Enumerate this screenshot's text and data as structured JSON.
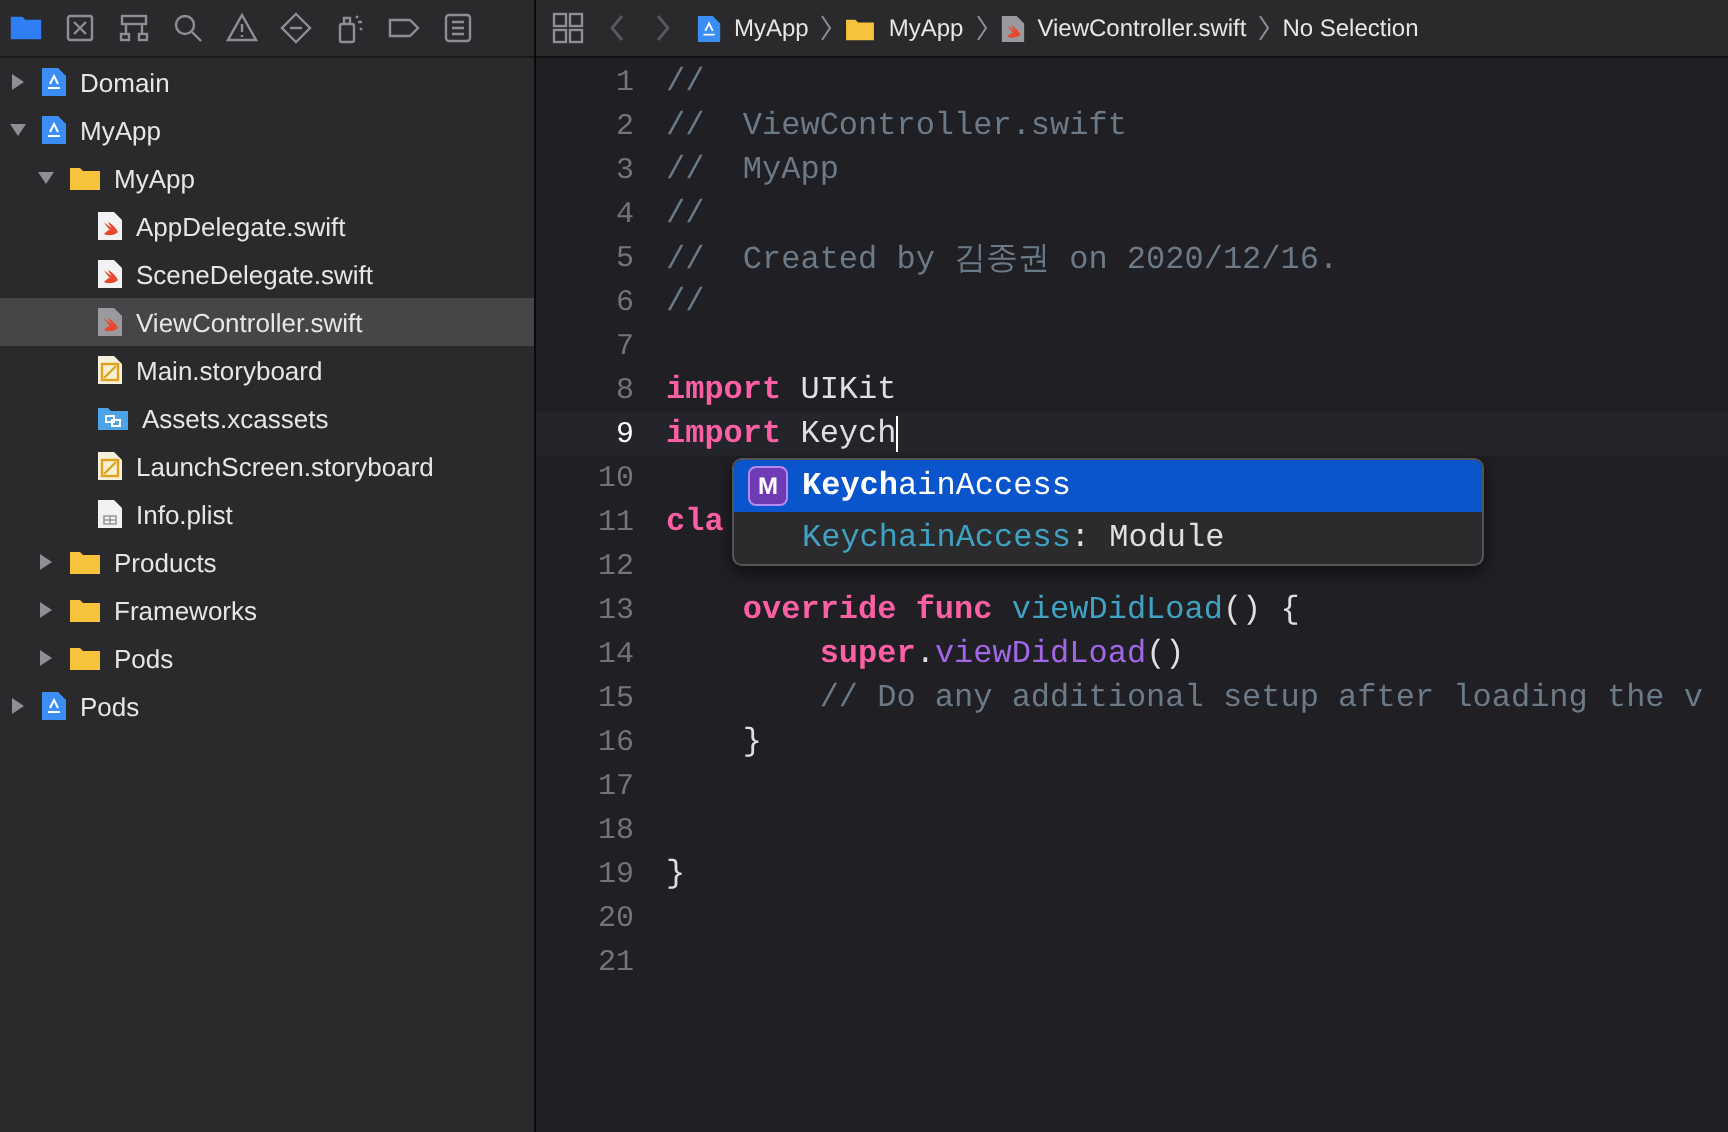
{
  "navigator": {
    "tabs": [
      {
        "kind": "folder",
        "selected": true
      },
      {
        "kind": "source-control",
        "selected": false
      },
      {
        "kind": "hierarchy",
        "selected": false
      },
      {
        "kind": "search",
        "selected": false
      },
      {
        "kind": "warning",
        "selected": false
      },
      {
        "kind": "test",
        "selected": false
      },
      {
        "kind": "debug",
        "selected": false
      },
      {
        "kind": "breakpoint",
        "selected": false
      },
      {
        "kind": "report",
        "selected": false
      }
    ],
    "tree": [
      {
        "label": "Domain",
        "kind": "project",
        "expanded": false,
        "selected": false
      },
      {
        "label": "MyApp",
        "kind": "project",
        "expanded": true,
        "selected": false,
        "children": [
          {
            "label": "MyApp",
            "kind": "folder",
            "expanded": true,
            "selected": false,
            "children": [
              {
                "label": "AppDelegate.swift",
                "kind": "swift",
                "selected": false
              },
              {
                "label": "SceneDelegate.swift",
                "kind": "swift",
                "selected": false
              },
              {
                "label": "ViewController.swift",
                "kind": "swift",
                "selected": true
              },
              {
                "label": "Main.storyboard",
                "kind": "storyboard",
                "selected": false
              },
              {
                "label": "Assets.xcassets",
                "kind": "assets",
                "selected": false
              },
              {
                "label": "LaunchScreen.storyboard",
                "kind": "storyboard",
                "selected": false
              },
              {
                "label": "Info.plist",
                "kind": "plist",
                "selected": false
              }
            ]
          },
          {
            "label": "Products",
            "kind": "folder",
            "expanded": false,
            "selected": false
          },
          {
            "label": "Frameworks",
            "kind": "folder",
            "expanded": false,
            "selected": false
          },
          {
            "label": "Pods",
            "kind": "folder",
            "expanded": false,
            "selected": false
          }
        ]
      },
      {
        "label": "Pods",
        "kind": "project",
        "expanded": false,
        "selected": false
      }
    ]
  },
  "breadcrumb": [
    {
      "kind": "project",
      "label": "MyApp"
    },
    {
      "kind": "folder",
      "label": "MyApp"
    },
    {
      "kind": "swift",
      "label": "ViewController.swift"
    },
    {
      "kind": "none",
      "label": "No Selection"
    }
  ],
  "editor": {
    "lines": [
      {
        "number": "1",
        "current": false,
        "tokens": [
          {
            "kind": "comment",
            "text": "//"
          }
        ]
      },
      {
        "number": "2",
        "current": false,
        "tokens": [
          {
            "kind": "comment",
            "text": "//  ViewController.swift"
          }
        ]
      },
      {
        "number": "3",
        "current": false,
        "tokens": [
          {
            "kind": "comment",
            "text": "//  MyApp"
          }
        ]
      },
      {
        "number": "4",
        "current": false,
        "tokens": [
          {
            "kind": "comment",
            "text": "//"
          }
        ]
      },
      {
        "number": "5",
        "current": false,
        "tokens": [
          {
            "kind": "comment",
            "text": "//  Created by 김종권 on 2020/12/16."
          }
        ]
      },
      {
        "number": "6",
        "current": false,
        "tokens": [
          {
            "kind": "comment",
            "text": "//"
          }
        ]
      },
      {
        "number": "7",
        "current": false
      },
      {
        "number": "8",
        "current": false,
        "tokens": [
          {
            "kind": "keyword",
            "text": "import"
          },
          {
            "kind": "plain",
            "text": " UIKit"
          }
        ]
      },
      {
        "number": "9",
        "current": true,
        "tokens": [
          {
            "kind": "keyword",
            "text": "import"
          },
          {
            "kind": "plain",
            "text": " Keych"
          }
        ]
      },
      {
        "number": "10",
        "current": false
      },
      {
        "number": "11",
        "current": false,
        "tokens": [
          {
            "kind": "keyword",
            "text": "cla"
          }
        ]
      },
      {
        "number": "12",
        "current": false
      },
      {
        "number": "13",
        "current": false,
        "tokens": [
          {
            "kind": "keyword",
            "text": "    override func"
          },
          {
            "kind": "declaration",
            "text": " viewDidLoad"
          },
          {
            "kind": "plain",
            "text": "() {"
          }
        ]
      },
      {
        "number": "14",
        "current": false,
        "tokens": [
          {
            "kind": "keyword",
            "text": "        super"
          },
          {
            "kind": "plain",
            "text": "."
          },
          {
            "kind": "call",
            "text": "viewDidLoad"
          },
          {
            "kind": "plain",
            "text": "()"
          }
        ]
      },
      {
        "number": "15",
        "current": false,
        "tokens": [
          {
            "kind": "comment",
            "text": "        // Do any additional setup after loading the v"
          }
        ]
      },
      {
        "number": "16",
        "current": false,
        "tokens": [
          {
            "kind": "plain",
            "text": "    }"
          }
        ]
      },
      {
        "number": "17",
        "current": false
      },
      {
        "number": "18",
        "current": false
      },
      {
        "number": "19",
        "current": false,
        "tokens": [
          {
            "kind": "plain",
            "text": "}"
          }
        ]
      },
      {
        "number": "20",
        "current": false
      },
      {
        "number": "21",
        "current": false
      }
    ],
    "completion": [
      {
        "selected": true,
        "badge": "M",
        "label": "**Keych**ainAccess"
      },
      {
        "selected": false,
        "label": "KeychainAccess",
        "detail": ": Module"
      }
    ]
  }
}
